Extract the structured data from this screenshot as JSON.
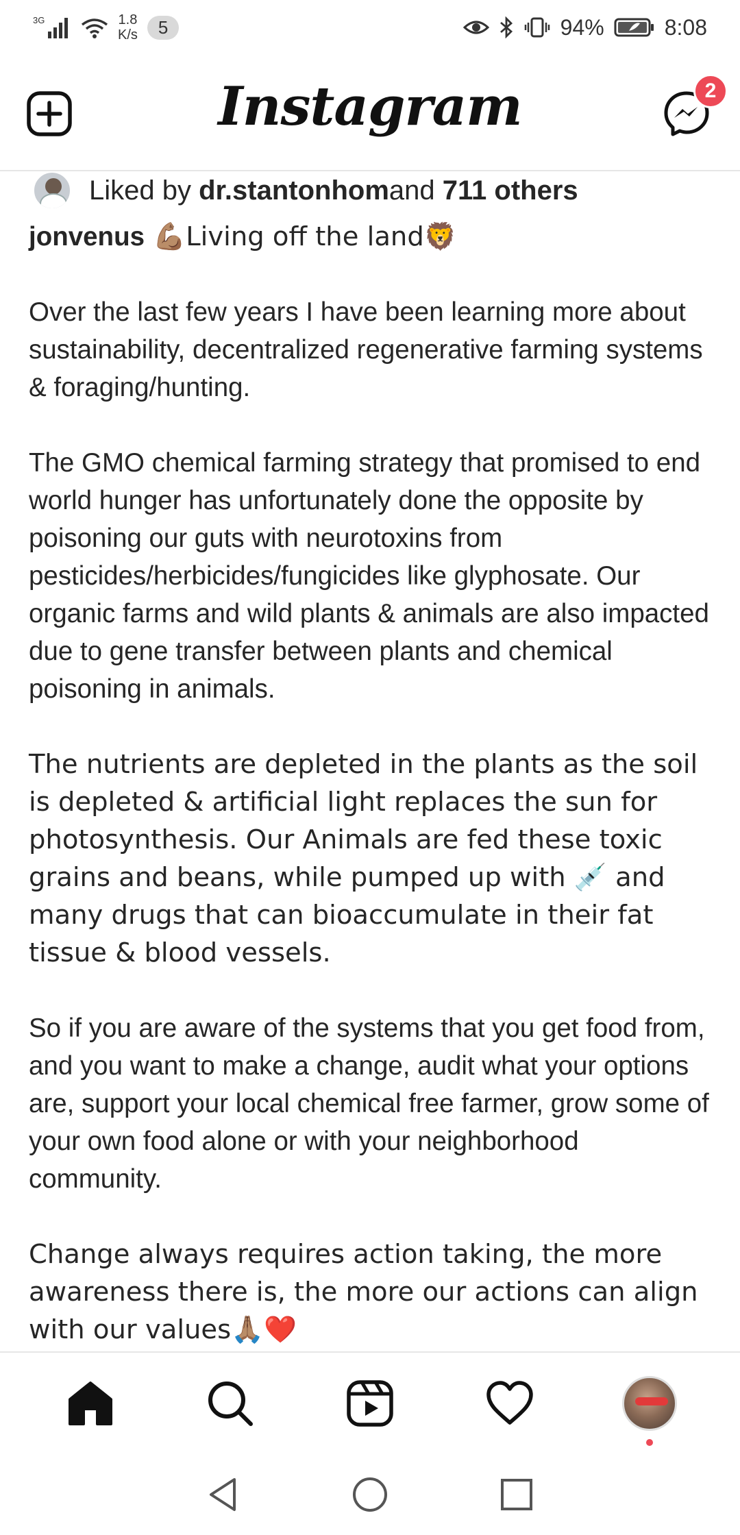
{
  "status_bar": {
    "network": "3G",
    "speed_value": "1.8",
    "speed_unit": "K/s",
    "notif_count": "5",
    "battery": "94%",
    "time": "8:08"
  },
  "header": {
    "logo": "Instagram",
    "dm_badge": "2"
  },
  "post": {
    "liked_prefix": "Liked by ",
    "liked_user": "dr.stantonhom",
    "liked_mid": " and ",
    "liked_others": "711 others",
    "author": "jonvenus",
    "caption_title": " 💪🏽Living off the land🦁",
    "paragraphs": [
      "Over the last few years I have been learning more about sustainability, decentralized regenerative farming systems & foraging/hunting.",
      "The GMO chemical farming strategy that promised to end world hunger has unfortunately done the opposite by poisoning our guts with neurotoxins from pesticides/herbicides/fungicides like glyphosate. Our organic farms and wild plants & animals are also impacted due to gene transfer between plants and chemical poisoning in animals.",
      "The nutrients are depleted in the plants as the soil is depleted & artificial light replaces the sun for photosynthesis. Our Animals are fed these toxic grains and beans, while pumped up with 💉 and many drugs that can bioaccumulate in their fat tissue & blood vessels.",
      "So if you are aware of the systems that you get food from, and you want to make a change, audit what your options are, support your local chemical free farmer, grow some of your own food alone or with your neighborhood community.",
      "Change always requires action taking, the more awareness there is, the more our actions can align with our values🙏🏽❤️"
    ]
  },
  "icons": {
    "new_post": "plus-square-icon",
    "messenger": "messenger-icon",
    "home": "home-icon",
    "search": "search-icon",
    "reels": "reels-icon",
    "activity": "heart-icon",
    "back": "back-triangle-icon",
    "home_sys": "home-circle-icon",
    "recents": "recents-square-icon"
  },
  "colors": {
    "badge": "#ed4956",
    "text": "#262626"
  }
}
